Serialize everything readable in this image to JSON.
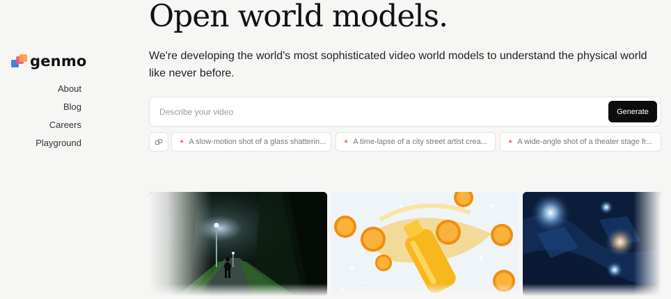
{
  "brand": {
    "name": "genmo"
  },
  "nav": {
    "items": [
      {
        "label": "About"
      },
      {
        "label": "Blog"
      },
      {
        "label": "Careers"
      },
      {
        "label": "Playground"
      }
    ]
  },
  "hero": {
    "title": "Open world models.",
    "subtitle": "We're developing the world's most sophisticated video world models to understand the physical world like never before."
  },
  "prompt": {
    "placeholder": "Describe your video",
    "value": "",
    "generate_label": "Generate"
  },
  "suggestions": {
    "icon": "link-icon",
    "items": [
      {
        "label": "A slow-motion shot of a glass shatterin..."
      },
      {
        "label": "A time-lapse of a city street artist crea..."
      },
      {
        "label": "A wide-angle shot of a theater stage fr..."
      }
    ]
  },
  "colors": {
    "background": "#f6f6f5",
    "button": "#0d0d0d",
    "sparkle": "#f06a6a",
    "logo_blue": "#4a7fe0",
    "logo_pink": "#f2547d",
    "logo_orange": "#f7a03a"
  }
}
